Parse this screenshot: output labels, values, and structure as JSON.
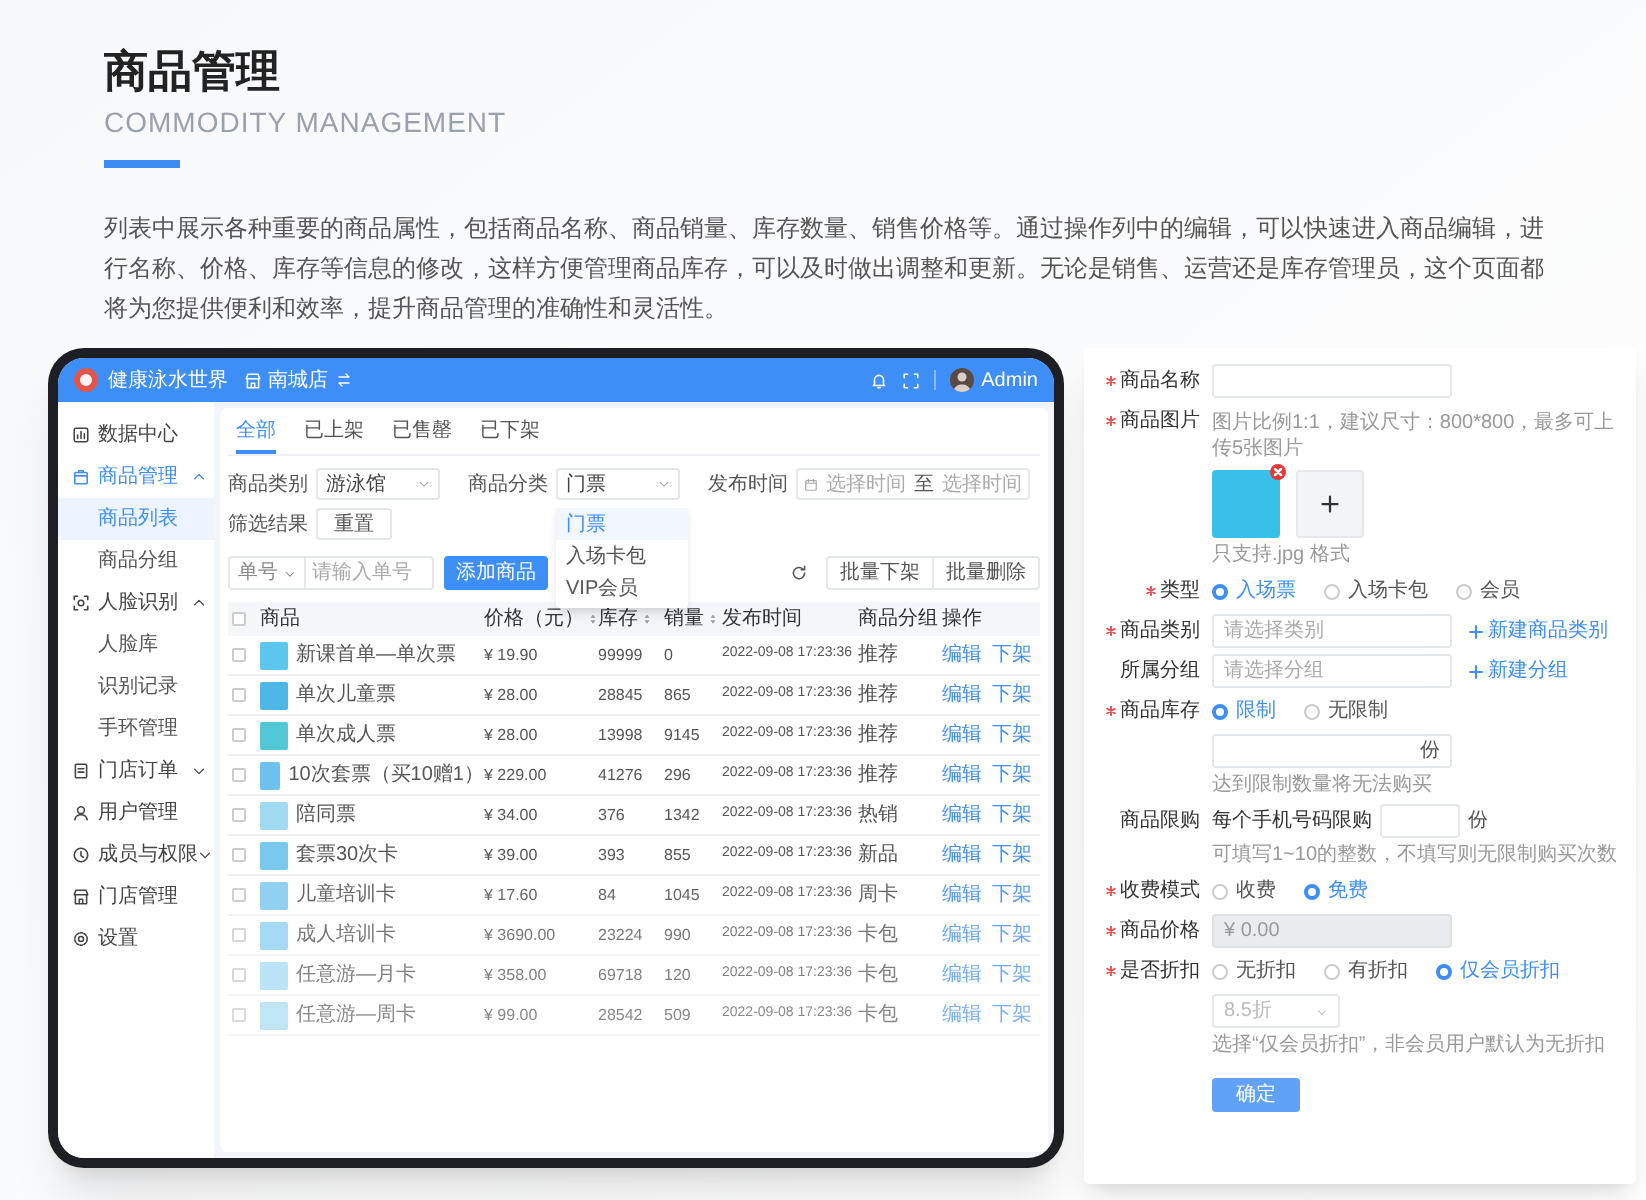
{
  "header": {
    "title": "商品管理",
    "subtitle": "COMMODITY MANAGEMENT",
    "description": "列表中展示各种重要的商品属性，包括商品名称、商品销量、库存数量、销售价格等。通过操作列中的编辑，可以快速进入商品编辑，进行名称、价格、库存等信息的修改，这样方便管理商品库存，可以及时做出调整和更新。无论是销售、运营还是库存管理员，这个页面都将为您提供便利和效率，提升商品管理的准确性和灵活性。"
  },
  "app": {
    "brand": "健康泳水世界",
    "store": "南城店",
    "user": "Admin",
    "sidebar": [
      {
        "label": "数据中心",
        "selected": false
      },
      {
        "label": "商品管理",
        "selected": true,
        "expanded": true,
        "children": [
          {
            "label": "商品列表",
            "selected": true
          },
          {
            "label": "商品分组",
            "selected": false
          }
        ]
      },
      {
        "label": "人脸识别",
        "selected": false,
        "expanded": true,
        "children": [
          {
            "label": "人脸库",
            "selected": false
          },
          {
            "label": "识别记录",
            "selected": false
          },
          {
            "label": "手环管理",
            "selected": false
          }
        ]
      },
      {
        "label": "门店订单",
        "selected": false,
        "expanded": false
      },
      {
        "label": "用户管理",
        "selected": false
      },
      {
        "label": "成员与权限",
        "selected": false,
        "expanded": false
      },
      {
        "label": "门店管理",
        "selected": false
      },
      {
        "label": "设置",
        "selected": false
      }
    ],
    "tabs": [
      {
        "label": "全部",
        "selected": true
      },
      {
        "label": "已上架",
        "selected": false
      },
      {
        "label": "已售罄",
        "selected": false
      },
      {
        "label": "已下架",
        "selected": false
      }
    ],
    "filters": {
      "category_label": "商品类别",
      "category_value": "游泳馆",
      "class_label": "商品分类",
      "class_value": "门票",
      "time_label": "发布时间",
      "time_start": "选择时间",
      "time_sep": "至",
      "time_end": "选择时间",
      "result_label": "筛选结果",
      "reset_button": "重置"
    },
    "dropdown": [
      {
        "label": "门票",
        "selected": true
      },
      {
        "label": "入场卡包",
        "selected": false
      },
      {
        "label": "VIP会员",
        "selected": false
      }
    ],
    "search": {
      "type": "单号",
      "placeholder": "请输入单号"
    },
    "add_button": "添加商品",
    "bulk_buttons": [
      "批量下架",
      "批量删除"
    ],
    "table": {
      "all_checked": false,
      "columns": [
        {
          "label": "商品",
          "sortable": false
        },
        {
          "label": "价格（元）",
          "sortable": true
        },
        {
          "label": "库存",
          "sortable": true
        },
        {
          "label": "销量",
          "sortable": true
        },
        {
          "label": "发布时间",
          "sortable": false
        },
        {
          "label": "商品分组",
          "sortable": false
        },
        {
          "label": "操作",
          "sortable": false
        }
      ],
      "rows": [
        {
          "name": "新课首单—单次票",
          "price": "¥ 19.90",
          "stock": "99999",
          "sales": "0",
          "time": "2022-09-08 17:23:36",
          "group": "推荐",
          "actions": [
            "编辑",
            "下架"
          ],
          "checked": false
        },
        {
          "name": "单次儿童票",
          "price": "¥ 28.00",
          "stock": "28845",
          "sales": "865",
          "time": "2022-09-08 17:23:36",
          "group": "推荐",
          "actions": [
            "编辑",
            "下架"
          ],
          "checked": false
        },
        {
          "name": "单次成人票",
          "price": "¥ 28.00",
          "stock": "13998",
          "sales": "9145",
          "time": "2022-09-08 17:23:36",
          "group": "推荐",
          "actions": [
            "编辑",
            "下架"
          ],
          "checked": false
        },
        {
          "name": "10次套票（买10赠1）",
          "price": "¥ 229.00",
          "stock": "41276",
          "sales": "296",
          "time": "2022-09-08 17:23:36",
          "group": "推荐",
          "actions": [
            "编辑",
            "下架"
          ],
          "checked": false
        },
        {
          "name": "陪同票",
          "price": "¥ 34.00",
          "stock": "376",
          "sales": "1342",
          "time": "2022-09-08 17:23:36",
          "group": "热销",
          "actions": [
            "编辑",
            "下架"
          ],
          "checked": false
        },
        {
          "name": "套票30次卡",
          "price": "¥ 39.00",
          "stock": "393",
          "sales": "855",
          "time": "2022-09-08 17:23:36",
          "group": "新品",
          "actions": [
            "编辑",
            "下架"
          ],
          "checked": false
        },
        {
          "name": "儿童培训卡",
          "price": "¥ 17.60",
          "stock": "84",
          "sales": "1045",
          "time": "2022-09-08 17:23:36",
          "group": "周卡",
          "actions": [
            "编辑",
            "下架"
          ],
          "checked": false
        },
        {
          "name": "成人培训卡",
          "price": "¥ 3690.00",
          "stock": "23224",
          "sales": "990",
          "time": "2022-09-08 17:23:36",
          "group": "卡包",
          "actions": [
            "编辑",
            "下架"
          ],
          "checked": false
        },
        {
          "name": "任意游—月卡",
          "price": "¥ 358.00",
          "stock": "69718",
          "sales": "120",
          "time": "2022-09-08 17:23:36",
          "group": "卡包",
          "actions": [
            "编辑",
            "下架"
          ],
          "checked": false
        },
        {
          "name": "任意游—周卡",
          "price": "¥ 99.00",
          "stock": "28542",
          "sales": "509",
          "time": "2022-09-08 17:23:36",
          "group": "卡包",
          "actions": [
            "编辑",
            "下架"
          ],
          "checked": false
        }
      ]
    }
  },
  "form": {
    "fields": [
      {
        "kind": "input",
        "label": "商品名称",
        "required": true,
        "disabled": false
      },
      {
        "kind": "images",
        "label": "商品图片",
        "required": true,
        "hint": "图片比例1:1，建议尺寸：800*800，最多可上传5张图片",
        "caption": "只支持.jpg 格式"
      },
      {
        "kind": "radio",
        "label": "类型",
        "required": true,
        "options": [
          {
            "label": "入场票",
            "selected": true
          },
          {
            "label": "入场卡包",
            "selected": false
          },
          {
            "label": "会员",
            "selected": false
          }
        ]
      },
      {
        "kind": "input",
        "label": "商品类别",
        "required": true,
        "placeholder": "请选择类别",
        "link": "新建商品类别",
        "disabled": false
      },
      {
        "kind": "input",
        "label": "所属分组",
        "required": false,
        "placeholder": "请选择分组",
        "link": "新建分组",
        "disabled": false
      },
      {
        "kind": "radio",
        "label": "商品库存",
        "required": true,
        "options": [
          {
            "label": "限制",
            "selected": true
          },
          {
            "label": "无限制",
            "selected": false
          }
        ]
      },
      {
        "kind": "input",
        "unit": "份",
        "hint": "达到限制数量将无法购买",
        "disabled": false
      },
      {
        "kind": "limit",
        "label": "商品限购",
        "required": false,
        "prefix": "每个手机号码限购",
        "unit": "份",
        "hint": "可填写1~10的整数，不填写则无限制购买次数"
      },
      {
        "kind": "radio",
        "label": "收费模式",
        "required": true,
        "options": [
          {
            "label": "收费",
            "selected": false
          },
          {
            "label": "免费",
            "selected": true
          }
        ]
      },
      {
        "kind": "input",
        "label": "商品价格",
        "required": true,
        "placeholder": "¥ 0.00",
        "disabled": true
      },
      {
        "kind": "radio",
        "label": "是否折扣",
        "required": true,
        "options": [
          {
            "label": "无折扣",
            "selected": false
          },
          {
            "label": "有折扣",
            "selected": false
          },
          {
            "label": "仅会员折扣",
            "selected": true
          }
        ]
      },
      {
        "kind": "select",
        "value": "8.5折",
        "hint": "选择“仅会员折扣”，非会员用户默认为无折扣"
      }
    ],
    "submit": "确定"
  }
}
